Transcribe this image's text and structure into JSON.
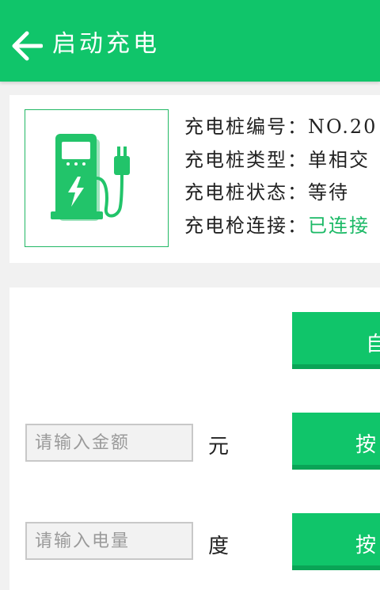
{
  "header": {
    "title": "启动充电",
    "back_icon": "arrow-left-icon"
  },
  "pile_info": {
    "icon": "charging-station-icon",
    "lines": [
      {
        "label": "充电桩编号：",
        "value": "NO.20"
      },
      {
        "label": "充电桩类型：",
        "value": "单相交"
      },
      {
        "label": "充电桩状态：",
        "value": "等待"
      },
      {
        "label": "充电枪连接：",
        "value": "已连接"
      }
    ]
  },
  "actions": {
    "auto_button": "自",
    "amount": {
      "placeholder": "请输入金额",
      "unit": "元",
      "button": "按"
    },
    "energy": {
      "placeholder": "请输入电量",
      "unit": "度",
      "button": "按"
    }
  },
  "colors": {
    "brand": "#10c56a",
    "status_green": "#1bb966"
  }
}
